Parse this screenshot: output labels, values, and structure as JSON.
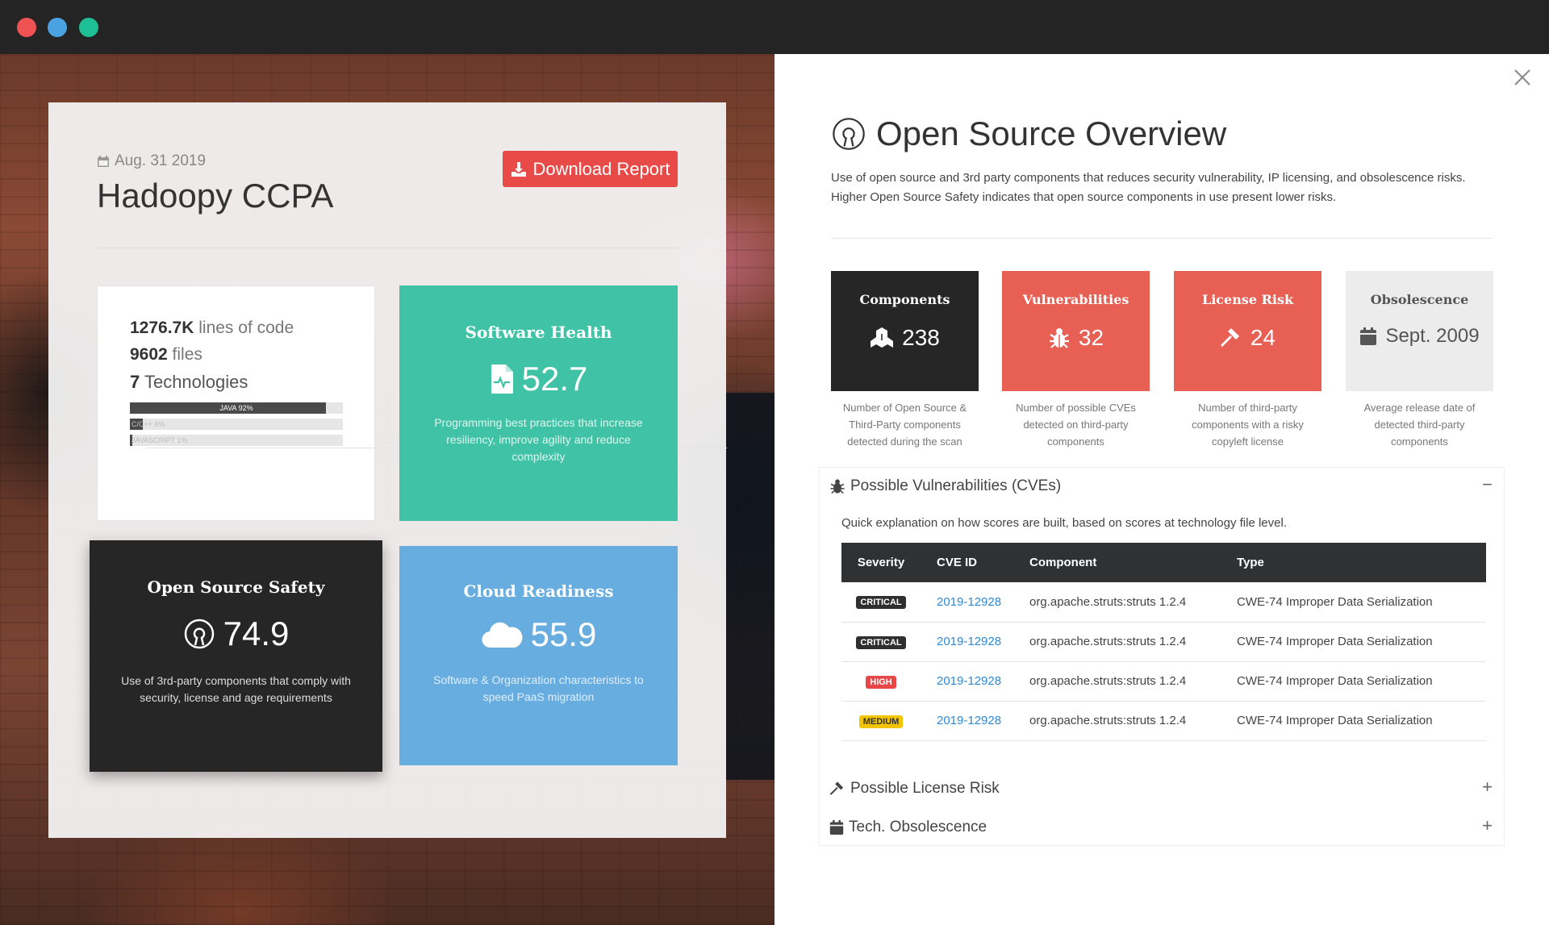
{
  "window": {
    "controls": [
      "close",
      "minimize",
      "maximize"
    ]
  },
  "report": {
    "date": "Aug. 31 2019",
    "title": "Hadoopy CCPA",
    "download_label": "Download Report",
    "lines_of_code_value": "1276.7K",
    "lines_of_code_label": " lines of code",
    "files_value": "9602",
    "files_label": " files",
    "technologies_count": "7",
    "technologies_label": " Technologies",
    "technologies": [
      {
        "label": "JAVA 92%",
        "percent": 92
      },
      {
        "label": "C/C++ 6%",
        "percent": 6
      },
      {
        "label": "JAVASCRIPT 1%",
        "percent": 1
      }
    ]
  },
  "tiles": {
    "health": {
      "title": "Software Health",
      "value": "52.7",
      "desc": "Programming best practices that increase resiliency, improve agility and reduce complexity",
      "color": "#40c2a6"
    },
    "safety": {
      "title": "Open Source Safety",
      "value": "74.9",
      "desc": "Use of 3rd-party components that comply with security, license and age requirements",
      "color": "#262626"
    },
    "cloud": {
      "title": "Cloud Readiness",
      "value": "55.9",
      "desc": "Software & Organization characteristics to speed PaaS migration",
      "color": "#68ade0"
    }
  },
  "panel": {
    "title": "Open Source Overview",
    "desc_line1": "Use of open source and 3rd party components that reduces security vulnerability, IP licensing, and obsolescence risks.",
    "desc_line2": "Higher Open Source Safety indicates that open source components in use present lower risks.",
    "metrics": [
      {
        "title": "Components",
        "value": "238",
        "icon": "cubes-icon",
        "desc": "Number of Open Source & Third-Party components detected during the scan"
      },
      {
        "title": "Vulnerabilities",
        "value": "32",
        "icon": "bug-icon",
        "desc": "Number of possible CVEs detected on third-party components"
      },
      {
        "title": "License Risk",
        "value": "24",
        "icon": "gavel-icon",
        "desc": "Number of third-party components with a risky copyleft license"
      },
      {
        "title": "Obsolescence",
        "value": "Sept. 2009",
        "icon": "calendar-icon",
        "desc": "Average release date of detected third-party components"
      }
    ],
    "vulnerabilities": {
      "heading": "Possible Vulnerabilities (CVEs)",
      "toggle": "−",
      "subtitle": "Quick explanation on how scores are built, based on scores at technology file level.",
      "columns": [
        "Severity",
        "CVE ID",
        "Component",
        "Type"
      ],
      "rows": [
        {
          "severity": "CRITICAL",
          "cve": "2019-12928",
          "component": "org.apache.struts:struts 1.2.4",
          "type": "CWE-74 Improper Data Serialization"
        },
        {
          "severity": "CRITICAL",
          "cve": "2019-12928",
          "component": "org.apache.struts:struts 1.2.4",
          "type": "CWE-74 Improper Data Serialization"
        },
        {
          "severity": "HIGH",
          "cve": "2019-12928",
          "component": "org.apache.struts:struts 1.2.4",
          "type": "CWE-74 Improper Data Serialization"
        },
        {
          "severity": "MEDIUM",
          "cve": "2019-12928",
          "component": "org.apache.struts:struts 1.2.4",
          "type": "CWE-74 Improper Data Serialization"
        }
      ]
    },
    "license_risk": {
      "heading": "Possible License Risk",
      "toggle": "+"
    },
    "obsolescence": {
      "heading": "Tech. Obsolescence",
      "toggle": "+"
    }
  },
  "colors": {
    "accent_red": "#e84a47",
    "critical": "#2f2f2f",
    "high": "#e84747",
    "medium": "#f2c500",
    "link": "#2d89d6"
  }
}
